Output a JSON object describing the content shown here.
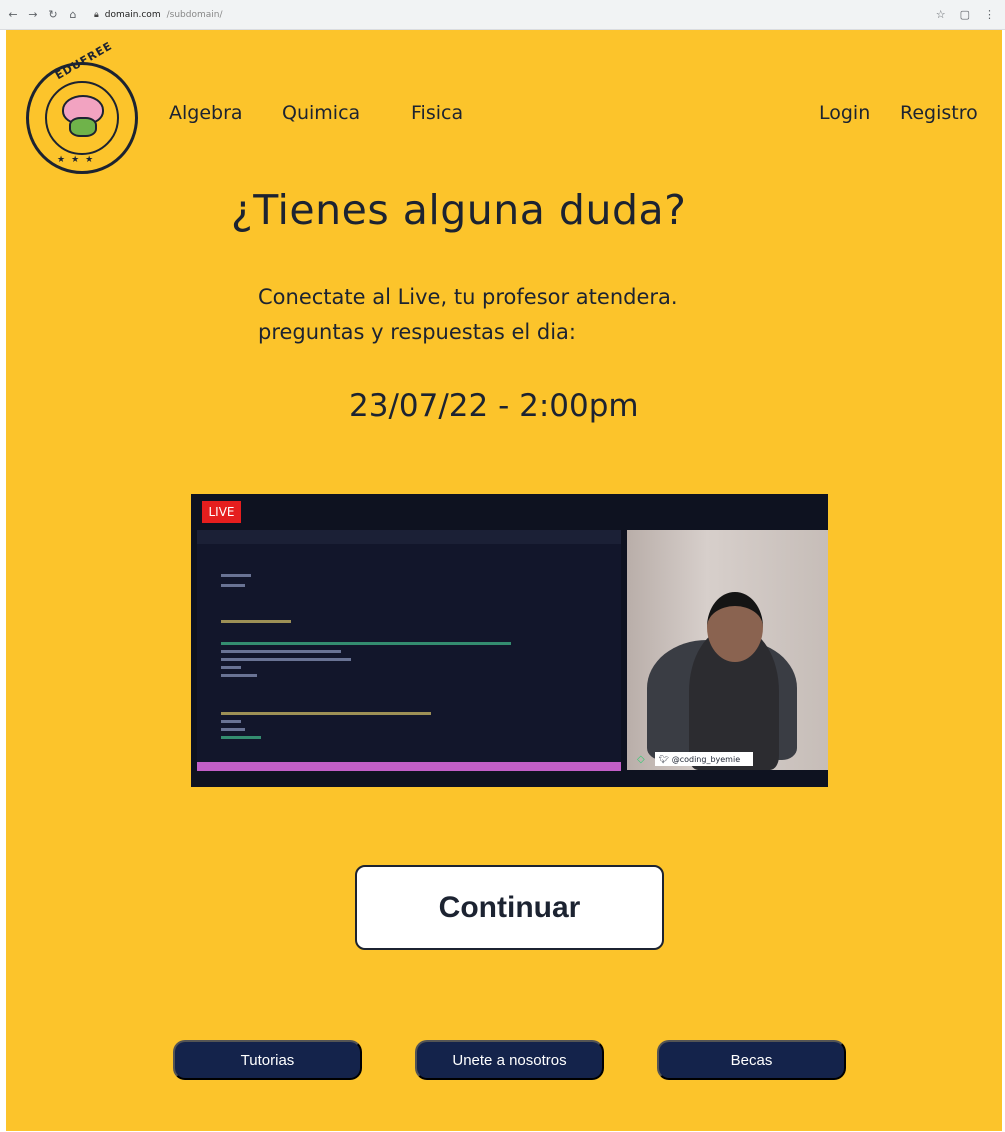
{
  "browser": {
    "back_icon": "arrow-left-icon",
    "forward_icon": "arrow-right-icon",
    "reload_icon": "reload-icon",
    "home_icon": "home-icon",
    "lock_icon": "lock-icon",
    "url_host": "domain.com",
    "url_path": "/subdomain/",
    "star_icon": "star-icon",
    "extensions_icon": "extensions-icon",
    "menu_icon": "kebab-menu-icon"
  },
  "brand": {
    "logo_text": "EDUFREE"
  },
  "nav": {
    "algebra": "Algebra",
    "quimica": "Quimica",
    "fisica": "Fisica",
    "login": "Login",
    "registro": "Registro"
  },
  "hero": {
    "title": "¿Tienes alguna duda?",
    "subtitle_line1": "Conectate al Live, tu profesor atendera.",
    "subtitle_line2": "preguntas y respuestas el dia:",
    "datetime": "23/07/22 - 2:00pm"
  },
  "video": {
    "live_label": "LIVE",
    "twitter_handle": "@coding_byemie"
  },
  "cta": {
    "continue_label": "Continuar"
  },
  "footer_buttons": {
    "tutorias": "Tutorias",
    "unete": "Unete a nosotros",
    "becas": "Becas"
  },
  "colors": {
    "background": "#fcc42b",
    "text_dark": "#1c2331",
    "pill_bg": "#14234b",
    "live_red": "#e51e1e"
  }
}
